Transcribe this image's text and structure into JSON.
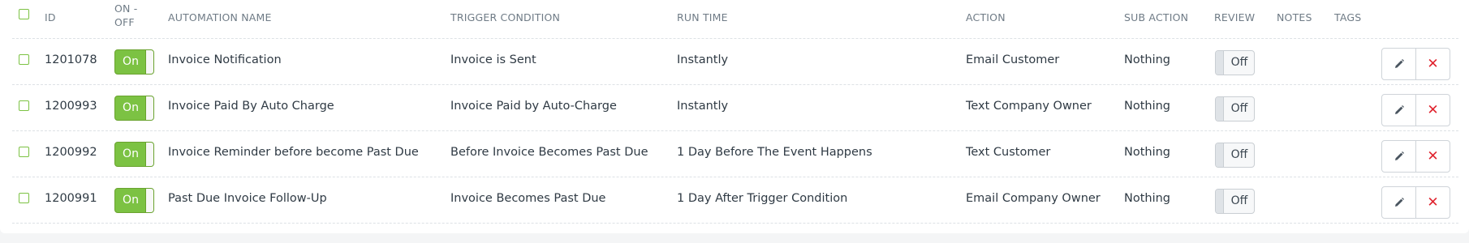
{
  "columns": {
    "id": "ID",
    "on_off_line1": "ON -",
    "on_off_line2": "OFF",
    "automation_name": "AUTOMATION NAME",
    "trigger_condition": "TRIGGER CONDITION",
    "run_time": "RUN TIME",
    "action": "ACTION",
    "sub_action": "SUB ACTION",
    "review": "REVIEW",
    "notes": "NOTES",
    "tags": "TAGS"
  },
  "rows": [
    {
      "id": "1201078",
      "toggle": "On",
      "name": "Invoice Notification",
      "trigger": "Invoice is Sent",
      "run_time": "Instantly",
      "action": "Email Customer",
      "sub_action": "Nothing",
      "review": "Off"
    },
    {
      "id": "1200993",
      "toggle": "On",
      "name": "Invoice Paid By Auto Charge",
      "trigger": "Invoice Paid by Auto-Charge",
      "run_time": "Instantly",
      "action": "Text Company Owner",
      "sub_action": "Nothing",
      "review": "Off"
    },
    {
      "id": "1200992",
      "toggle": "On",
      "name": "Invoice Reminder before become Past Due",
      "trigger": "Before Invoice Becomes Past Due",
      "run_time": "1 Day Before The Event Happens",
      "action": "Text Customer",
      "sub_action": "Nothing",
      "review": "Off"
    },
    {
      "id": "1200991",
      "toggle": "On",
      "name": "Past Due Invoice Follow-Up",
      "trigger": "Invoice Becomes Past Due",
      "run_time": "1 Day After Trigger Condition",
      "action": "Email Company Owner",
      "sub_action": "Nothing",
      "review": "Off"
    }
  ],
  "icons": {
    "edit": "pencil-icon",
    "delete": "x-icon"
  },
  "colors": {
    "accent_green": "#7cc243",
    "delete_red": "#e0232e"
  }
}
